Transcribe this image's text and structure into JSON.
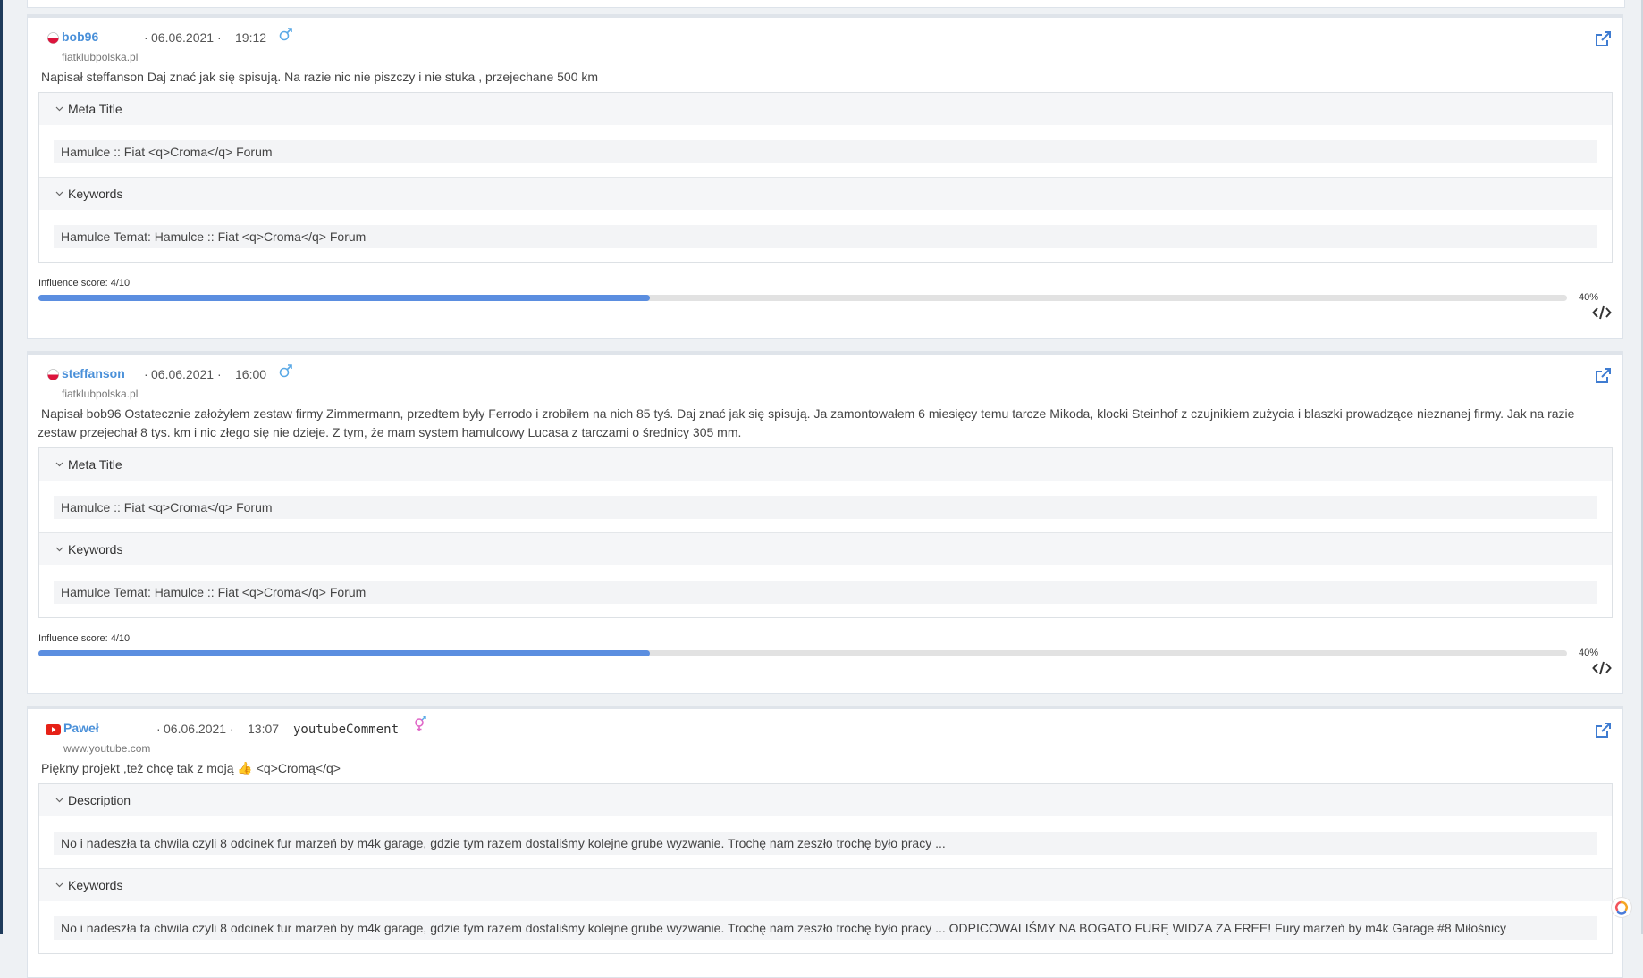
{
  "posts": [
    {
      "author": "bob96",
      "date": "06.06.2021",
      "time": "19:12",
      "domain": "fiatklubpolska.pl",
      "text": "Napisał steffanson Daj znać jak się spisują. Na razie nic nie piszczy i nie stuka , przejechane 500 km",
      "sections": [
        {
          "label": "Meta Title",
          "value": "Hamulce :: Fiat <q>Croma</q> Forum"
        },
        {
          "label": "Keywords",
          "value": "Hamulce Temat: Hamulce :: Fiat <q>Croma</q> Forum"
        }
      ],
      "influence_label": "Influence score: 4/10",
      "influence": 0.4,
      "percent_label": "40%"
    },
    {
      "author": "steffanson",
      "date": "06.06.2021",
      "time": "16:00",
      "domain": "fiatklubpolska.pl",
      "text": "Napisał bob96 Ostatecznie założyłem zestaw firmy Zimmermann, przedtem były Ferrodo i zrobiłem na nich 85 tyś. Daj znać jak się spisują. Ja zamontowałem 6 miesięcy temu tarcze Mikoda, klocki Steinhof z czujnikiem zużycia i blaszki prowadzące nieznanej firmy. Jak na razie zestaw przejechał 8 tys. km i nic złego się nie dzieje. Z tym, że mam system hamulcowy Lucasa z tarczami o średnicy 305 mm.",
      "sections": [
        {
          "label": "Meta Title",
          "value": "Hamulce :: Fiat <q>Croma</q> Forum"
        },
        {
          "label": "Keywords",
          "value": "Hamulce Temat: Hamulce :: Fiat <q>Croma</q> Forum"
        }
      ],
      "influence_label": "Influence score: 4/10",
      "influence": 0.4,
      "percent_label": "40%"
    },
    {
      "author": "Paweł",
      "date": "06.06.2021",
      "time": "13:07",
      "type": "youtubeComment",
      "domain": "www.youtube.com",
      "text": "Piękny projekt ,też chcę tak z moją 👍 <q>Cromą</q>",
      "sections": [
        {
          "label": "Description",
          "value": "No i nadeszła ta chwila czyli 8 odcinek fur marzeń by m4k garage, gdzie tym razem dostaliśmy kolejne grube wyzwanie. Trochę nam zeszło trochę było pracy ..."
        },
        {
          "label": "Keywords",
          "value": "No i nadeszła ta chwila czyli 8 odcinek fur marzeń by m4k garage, gdzie tym razem dostaliśmy kolejne grube wyzwanie. Trochę nam zeszło trochę było pracy ... ODPICOWALIŚMY NA BOGATO FURĘ WIDZA ZA FREE! Fury marzeń by m4k Garage #8 Miłośnicy"
        }
      ]
    }
  ],
  "separator": "·",
  "colors": {
    "accent": "#4a90d9",
    "progress": "#5b8ee0",
    "male": "#5aa9e6",
    "female": "#e066c7",
    "youtube": "#e62117"
  },
  "icons": [
    "poland-flag-icon",
    "youtube-icon",
    "male-icon",
    "female-icon",
    "external-link-icon",
    "chevron-down-icon",
    "code-icon",
    "app-logo-icon"
  ]
}
